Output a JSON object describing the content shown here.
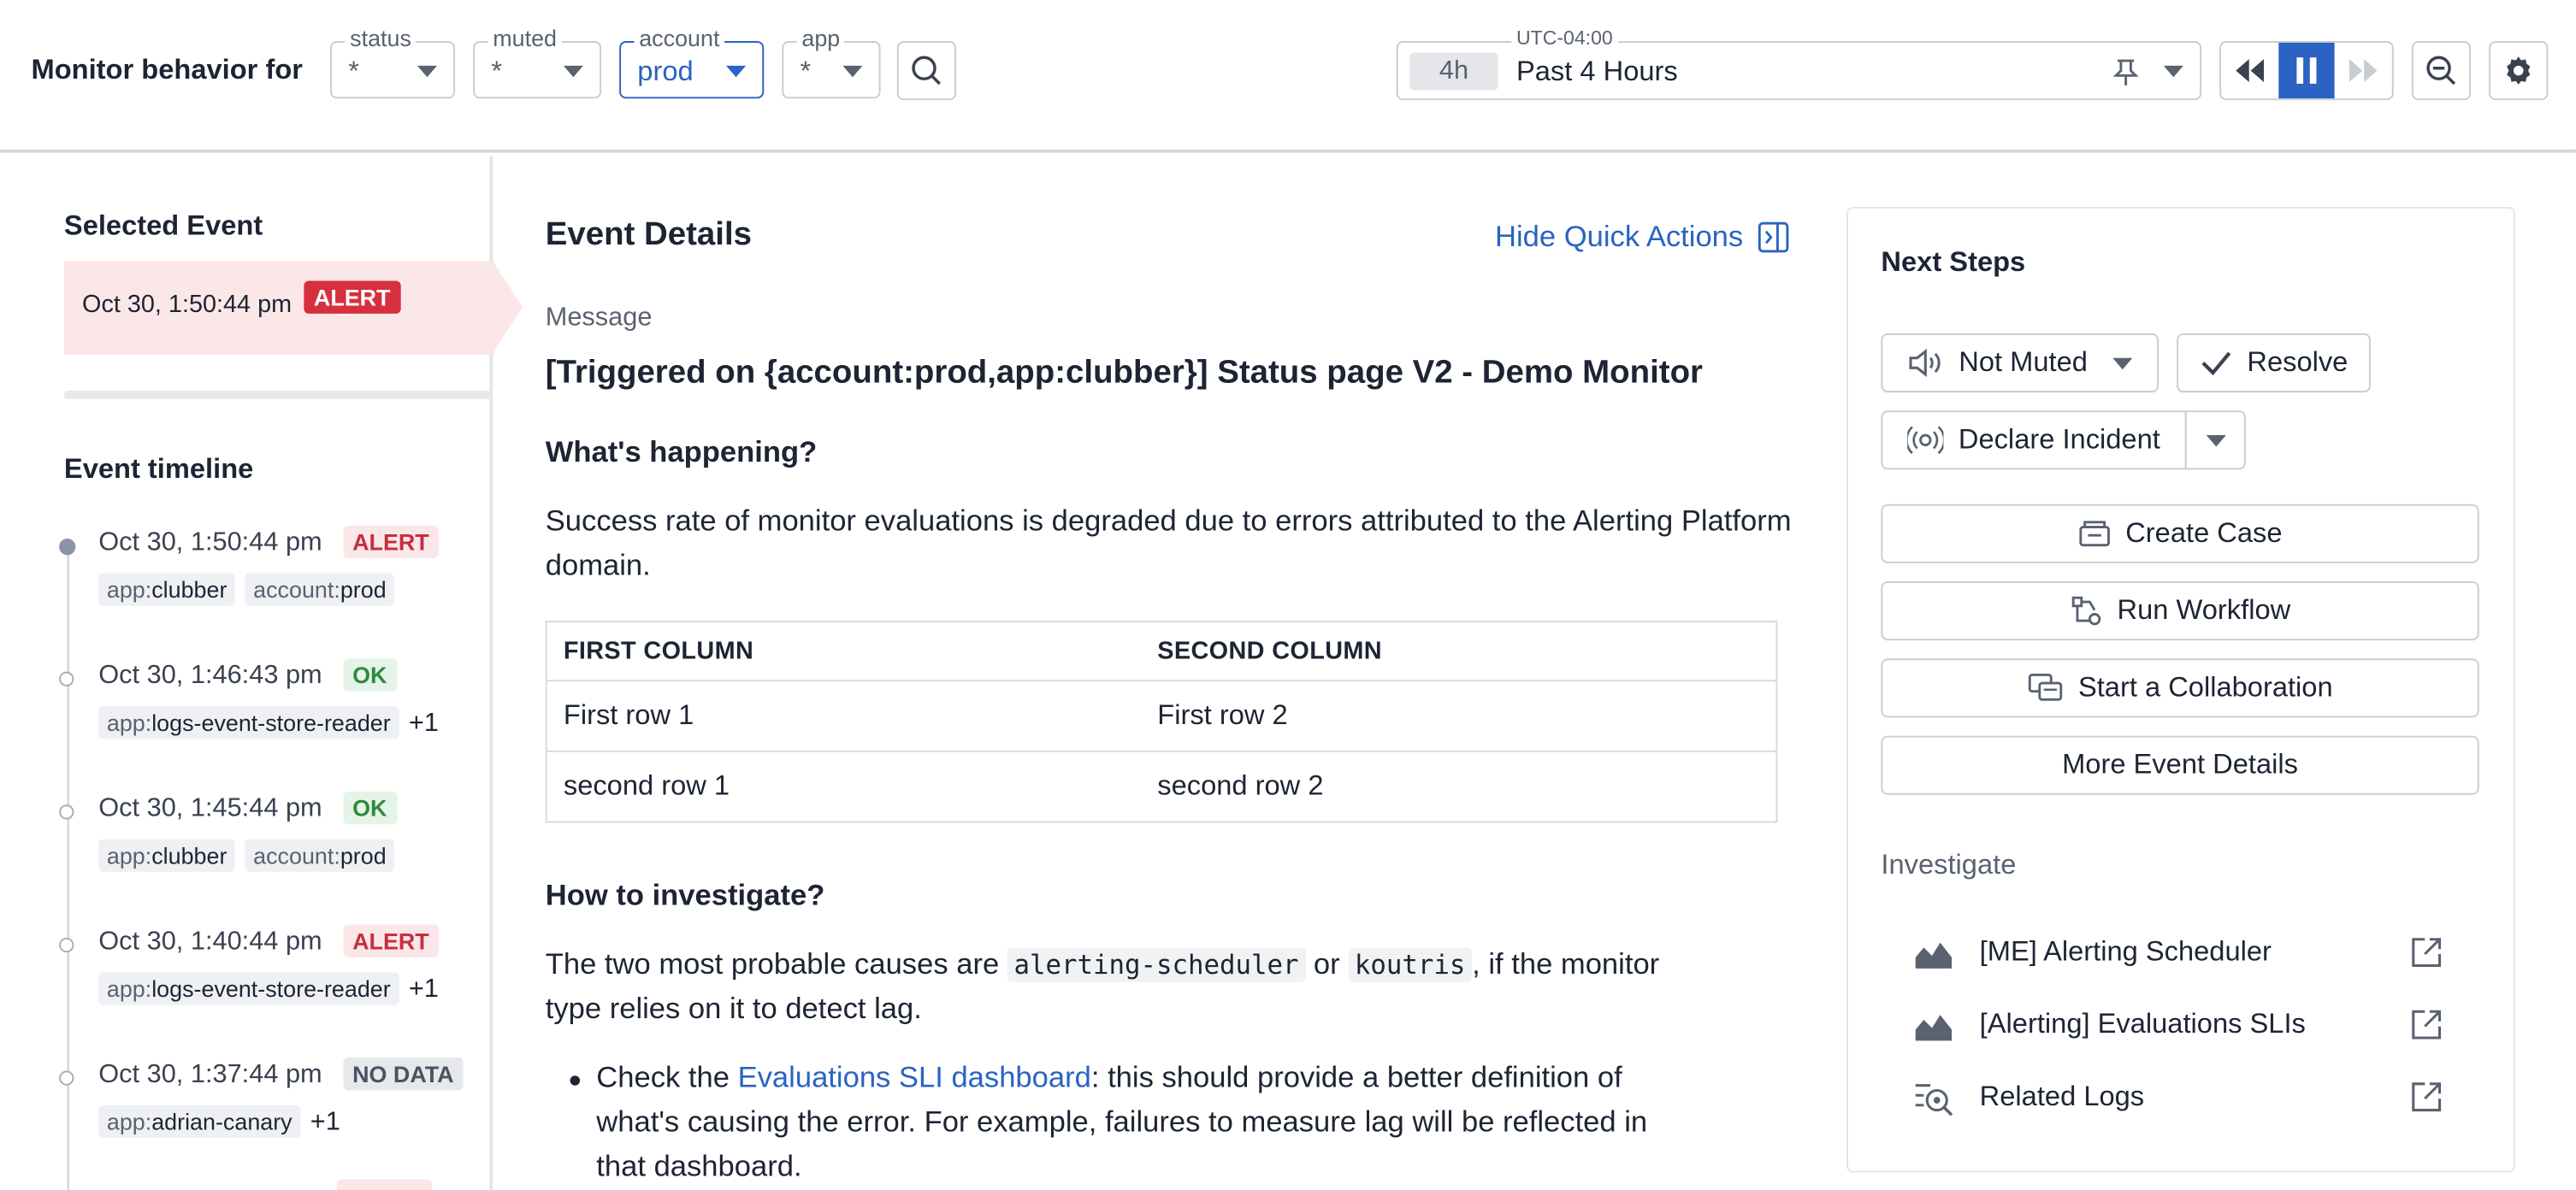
{
  "header": {
    "title": "Monitor behavior for",
    "filters": [
      {
        "label": "status",
        "value": "*"
      },
      {
        "label": "muted",
        "value": "*"
      },
      {
        "label": "account",
        "value": "prod"
      },
      {
        "label": "app",
        "value": "*"
      }
    ],
    "timezone": "UTC-04:00",
    "time_chip": "4h",
    "time_range": "Past 4 Hours"
  },
  "left": {
    "selected_title": "Selected Event",
    "selected_time": "Oct 30, 1:50:44 pm",
    "selected_status": "ALERT",
    "timeline_title": "Event timeline",
    "events": [
      {
        "time": "Oct 30, 1:50:44 pm",
        "status": "ALERT",
        "tags": [
          {
            "k": "app:",
            "v": "clubber"
          },
          {
            "k": "account:",
            "v": "prod"
          }
        ],
        "more": ""
      },
      {
        "time": "Oct 30, 1:46:43 pm",
        "status": "OK",
        "tags": [
          {
            "k": "app:",
            "v": "logs-event-store-reader"
          }
        ],
        "more": "+1"
      },
      {
        "time": "Oct 30, 1:45:44 pm",
        "status": "OK",
        "tags": [
          {
            "k": "app:",
            "v": "clubber"
          },
          {
            "k": "account:",
            "v": "prod"
          }
        ],
        "more": ""
      },
      {
        "time": "Oct 30, 1:40:44 pm",
        "status": "ALERT",
        "tags": [
          {
            "k": "app:",
            "v": "logs-event-store-reader"
          }
        ],
        "more": "+1"
      },
      {
        "time": "Oct 30, 1:37:44 pm",
        "status": "NO DATA",
        "tags": [
          {
            "k": "app:",
            "v": "adrian-canary"
          }
        ],
        "more": "+1"
      }
    ]
  },
  "details": {
    "title": "Event Details",
    "hide_quick_actions": "Hide Quick Actions",
    "message_label": "Message",
    "message": "[Triggered on {account:prod,app:clubber}] Status page V2 - Demo Monitor",
    "whats_happening": "What's happening?",
    "whats_happening_text": "Success rate of monitor evaluations is degraded due to errors attributed to the Alerting Platform domain.",
    "table": {
      "headers": [
        "FIRST COLUMN",
        "SECOND COLUMN"
      ],
      "rows": [
        [
          "First row 1",
          "First row 2"
        ],
        [
          "second row 1",
          "second row 2"
        ]
      ]
    },
    "how_title": "How to investigate?",
    "how_text_1": "The two most probable causes are ",
    "code_1": "alerting-scheduler",
    "how_text_or": " or ",
    "code_2": "koutris",
    "how_text_2": ", if the monitor",
    "how_text_3": "type relies on it to detect lag.",
    "bullet_pre": "Check the ",
    "bullet_link": "Evaluations SLI dashboard",
    "bullet_post_1": ": this should provide a better definition of",
    "bullet_post_2": "what's causing the error. For example, failures to measure lag will be reflected in",
    "bullet_post_3": "that dashboard."
  },
  "next_steps": {
    "title": "Next Steps",
    "not_muted": "Not Muted",
    "resolve": "Resolve",
    "declare_incident": "Declare Incident",
    "create_case": "Create Case",
    "run_workflow": "Run Workflow",
    "start_collab": "Start a Collaboration",
    "more_details": "More Event Details",
    "investigate_title": "Investigate",
    "links": [
      {
        "label": "[ME] Alerting Scheduler",
        "icon": "area-chart-icon"
      },
      {
        "label": "[Alerting] Evaluations SLIs",
        "icon": "area-chart-icon"
      },
      {
        "label": "Related Logs",
        "icon": "logs-search-icon"
      }
    ]
  }
}
